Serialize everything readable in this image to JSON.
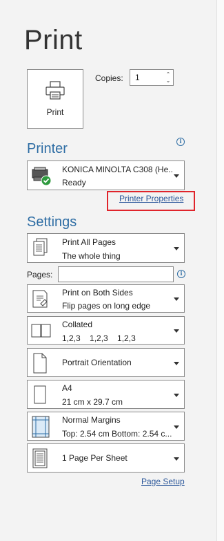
{
  "title": "Print",
  "print_button": {
    "label": "Print"
  },
  "copies": {
    "label": "Copies:",
    "value": "1"
  },
  "printer": {
    "heading": "Printer",
    "name": "KONICA MINOLTA C308 (He...",
    "status": "Ready",
    "properties_link": "Printer Properties"
  },
  "settings": {
    "heading": "Settings",
    "pages_label": "Pages:",
    "pages_value": "",
    "items": [
      {
        "line1": "Print All Pages",
        "line2": "The whole thing",
        "icon": "pages-icon"
      },
      {
        "line1": "Print on Both Sides",
        "line2": "Flip pages on long edge",
        "icon": "duplex-icon"
      },
      {
        "line1": "Collated",
        "line2": "1,2,3    1,2,3    1,2,3",
        "icon": "collate-icon"
      },
      {
        "line1": "Portrait Orientation",
        "line2": "",
        "icon": "portrait-icon"
      },
      {
        "line1": "A4",
        "line2": "21 cm x 29.7 cm",
        "icon": "paper-size-icon"
      },
      {
        "line1": "Normal Margins",
        "line2": "Top: 2.54 cm Bottom: 2.54 c...",
        "icon": "margins-icon"
      },
      {
        "line1": "1 Page Per Sheet",
        "line2": "",
        "icon": "pages-per-sheet-icon"
      }
    ],
    "page_setup_link": "Page Setup"
  },
  "colors": {
    "accent": "#2e6da4",
    "link": "#2b579a",
    "highlight": "#e0242b"
  }
}
